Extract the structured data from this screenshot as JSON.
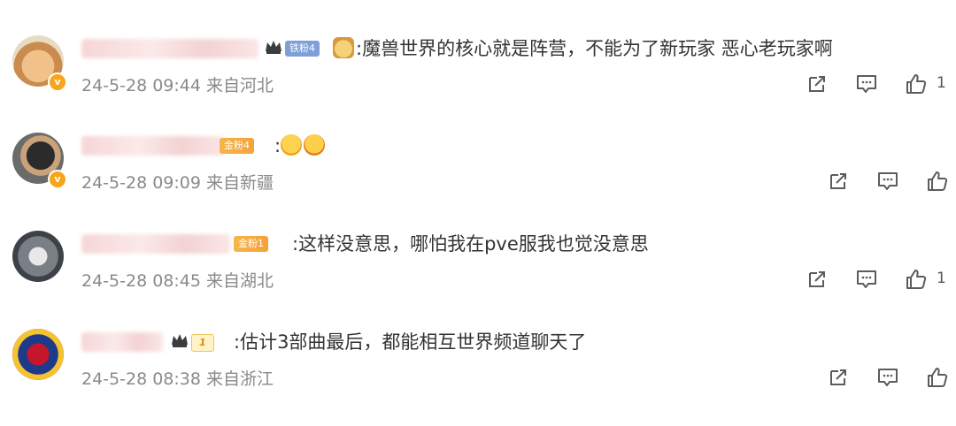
{
  "comments": [
    {
      "fan_badge": "铁粉4",
      "text": ":魔兽世界的核心就是阵营，不能为了新玩家 恶心老玩家啊",
      "time": "24-5-28 09:44",
      "location": "来自河北",
      "likes": "1"
    },
    {
      "fan_badge": "金粉4",
      "text": ":",
      "time": "24-5-28 09:09",
      "location": "来自新疆",
      "likes": ""
    },
    {
      "fan_badge": "金粉1",
      "text": ":这样没意思，哪怕我在pve服我也觉没意思",
      "time": "24-5-28 08:45",
      "location": "来自湖北",
      "likes": "1"
    },
    {
      "fan_badge": "1",
      "text": ":估计3部曲最后，都能相互世界频道聊天了",
      "time": "24-5-28 08:38",
      "location": "来自浙江",
      "likes": ""
    }
  ],
  "icons": {
    "share": "share-icon",
    "reply": "comment-icon",
    "like": "thumbs-up-icon",
    "verified": "verified-badge-icon",
    "crown": "crown-icon"
  },
  "colors": {
    "text": "#333333",
    "meta": "#8a8a8a",
    "icon": "#5c5c5c",
    "verified": "#f7a51b"
  }
}
